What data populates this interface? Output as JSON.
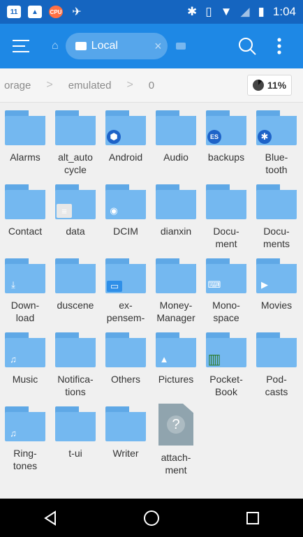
{
  "status": {
    "time": "1:04",
    "notif_icons": [
      "calendar-icon",
      "photos-icon",
      "cpu-icon",
      "send-icon"
    ],
    "calendar_text": "11",
    "cpu_text": "CPU",
    "right_icons": [
      "bluetooth-icon",
      "vibrate-icon",
      "wifi-icon",
      "no-signal-icon",
      "battery-icon"
    ]
  },
  "toolbar": {
    "tab_label": "Local",
    "close_glyph": "×"
  },
  "path": {
    "crumbs": [
      "orage",
      "emulated",
      "0"
    ],
    "storage_percent": "11%"
  },
  "folders": [
    {
      "name": "Alarms",
      "badge": ""
    },
    {
      "name": "alt_autocycle",
      "label": "alt_auto\ncycle",
      "badge": ""
    },
    {
      "name": "Android",
      "badge": "android"
    },
    {
      "name": "Audio",
      "badge": ""
    },
    {
      "name": "backups",
      "badge": "es"
    },
    {
      "name": "Bluetooth",
      "label": "Blue-\ntooth",
      "badge": "bluetooth"
    },
    {
      "name": "Contact",
      "badge": ""
    },
    {
      "name": "data",
      "badge": "data"
    },
    {
      "name": "DCIM",
      "badge": "camera"
    },
    {
      "name": "dianxin",
      "badge": ""
    },
    {
      "name": "Document",
      "label": "Docu-\nment",
      "badge": ""
    },
    {
      "name": "Documents",
      "label": "Docu-\nments",
      "badge": ""
    },
    {
      "name": "Download",
      "label": "Down-\nload",
      "badge": "download"
    },
    {
      "name": "duscene",
      "badge": ""
    },
    {
      "name": "expensem",
      "label": "ex-\npensem-",
      "badge": "card"
    },
    {
      "name": "MoneyManager",
      "label": "Money-\nManager",
      "badge": ""
    },
    {
      "name": "Monospace",
      "label": "Mono-\nspace",
      "badge": "typewriter"
    },
    {
      "name": "Movies",
      "badge": "play"
    },
    {
      "name": "Music",
      "badge": "music"
    },
    {
      "name": "Notifications",
      "label": "Notifica-\ntions",
      "badge": ""
    },
    {
      "name": "Others",
      "badge": ""
    },
    {
      "name": "Pictures",
      "badge": "picture"
    },
    {
      "name": "PocketBook",
      "label": "Pocket-\nBook",
      "badge": "books"
    },
    {
      "name": "Podcasts",
      "label": "Pod-\ncasts",
      "badge": ""
    },
    {
      "name": "Ringtones",
      "label": "Ring-\ntones",
      "badge": "music"
    },
    {
      "name": "t-ui",
      "badge": ""
    },
    {
      "name": "Writer",
      "badge": ""
    },
    {
      "name": "attachment",
      "label": "attach-\nment",
      "type": "file",
      "badge": "question"
    }
  ],
  "colors": {
    "statusbar": "#1565c0",
    "toolbar": "#1e88e5",
    "folder": "#74b8f0",
    "background": "#f0f0f0"
  }
}
